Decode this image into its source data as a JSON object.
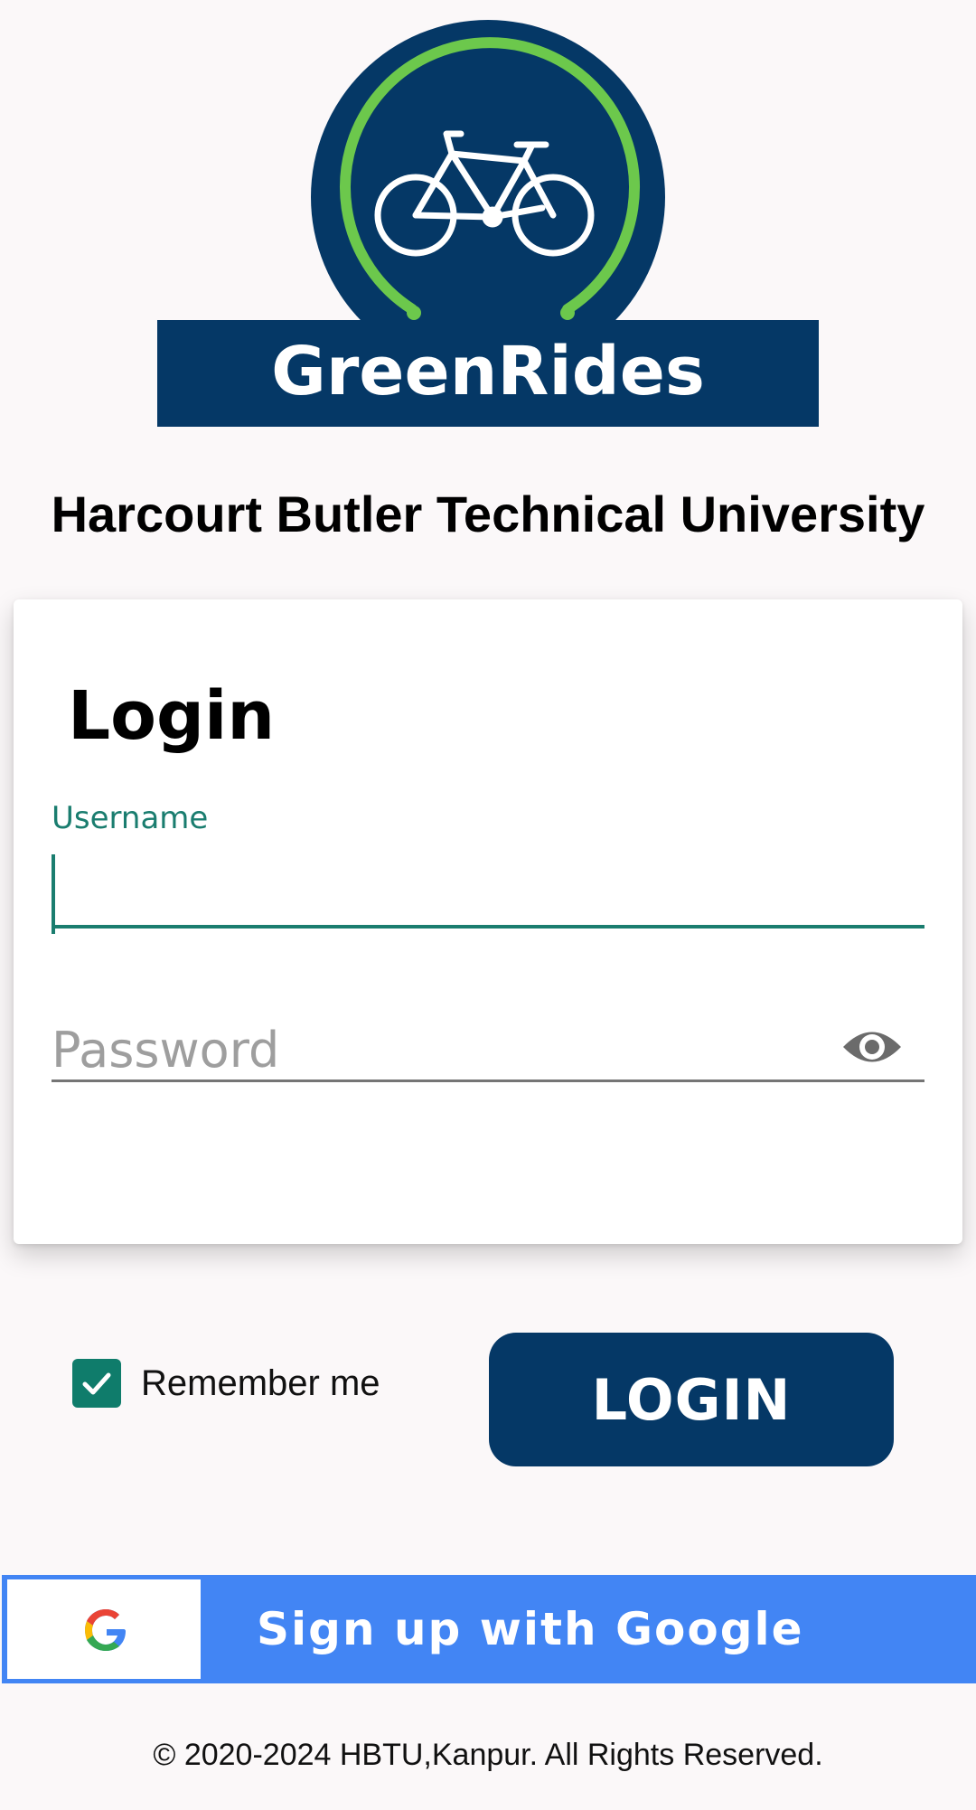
{
  "app": {
    "brand_name": "GreenRides",
    "university_name": "Harcourt Butler Technical University",
    "colors": {
      "primary_navy": "#053866",
      "accent_green": "#6cc84c",
      "teal": "#1a7d6f",
      "google_blue": "#4285f4"
    }
  },
  "login_card": {
    "title": "Login",
    "username_label": "Username",
    "username_value": "",
    "password_placeholder": "Password",
    "password_value": "",
    "visibility_icon": "eye-icon"
  },
  "actions": {
    "remember_label": "Remember me",
    "remember_checked": true,
    "login_label": "LOGIN"
  },
  "google": {
    "label": "Sign up with Google",
    "icon": "google-icon"
  },
  "footer": {
    "text": "© 2020-2024 HBTU,Kanpur. All Rights Reserved."
  }
}
